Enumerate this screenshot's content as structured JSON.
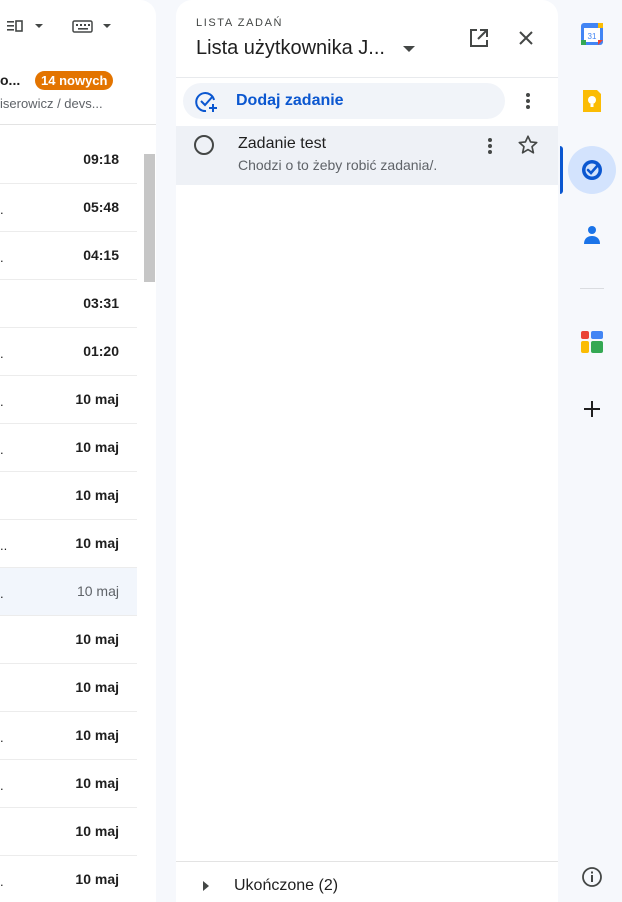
{
  "mail": {
    "sender_truncated": "o...",
    "new_badge": "14 nowych",
    "path_truncated": "iserowicz / devs...",
    "rows": [
      {
        "dot": "",
        "time": "09:18",
        "unread": true
      },
      {
        "dot": ".",
        "time": "05:48",
        "unread": true
      },
      {
        "dot": ".",
        "time": "04:15",
        "unread": true
      },
      {
        "dot": "",
        "time": "03:31",
        "unread": true
      },
      {
        "dot": ".",
        "time": "01:20",
        "unread": true
      },
      {
        "dot": ".",
        "time": "10 maj",
        "unread": true
      },
      {
        "dot": ".",
        "time": "10 maj",
        "unread": true
      },
      {
        "dot": "",
        "time": "10 maj",
        "unread": true
      },
      {
        "dot": "..",
        "time": "10 maj",
        "unread": true
      },
      {
        "dot": ".",
        "time": "10 maj",
        "unread": false
      },
      {
        "dot": "",
        "time": "10 maj",
        "unread": true
      },
      {
        "dot": "",
        "time": "10 maj",
        "unread": true
      },
      {
        "dot": ".",
        "time": "10 maj",
        "unread": true
      },
      {
        "dot": ".",
        "time": "10 maj",
        "unread": true
      },
      {
        "dot": "",
        "time": "10 maj",
        "unread": true
      },
      {
        "dot": ".",
        "time": "10 maj",
        "unread": true
      }
    ]
  },
  "tasks": {
    "caption": "LISTA ZADAŃ",
    "list_title": "Lista użytkownika J...",
    "add_label": "Dodaj zadanie",
    "items": [
      {
        "title": "Zadanie test",
        "note": "Chodzi o to żeby robić zadania/."
      }
    ],
    "completed_label": "Ukończone (2)"
  },
  "rail": {
    "calendar_day": "31",
    "icons": [
      "calendar-icon",
      "keep-icon",
      "tasks-icon",
      "contacts-icon",
      "apps-icon",
      "add-icon",
      "info-icon"
    ]
  },
  "colors": {
    "accent": "#0b57d0",
    "badge": "#e37400",
    "active_bg": "#d3e3fd"
  }
}
